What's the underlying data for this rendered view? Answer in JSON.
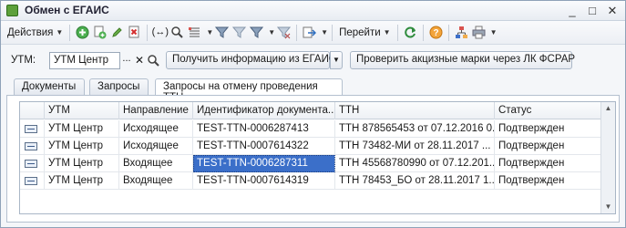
{
  "window": {
    "title": "Обмен с ЕГАИС",
    "controls": [
      "_",
      "□",
      "✕"
    ]
  },
  "toolbar": {
    "actions_label": "Действия",
    "goto_label": "Перейти",
    "icons": [
      "add-icon",
      "copy-icon",
      "edit-icon",
      "delete-icon",
      "pair-icon",
      "find-icon",
      "list-icon",
      "filter-icon",
      "filter-options-icon",
      "clear-filter-icon",
      "export-icon",
      "refresh-icon",
      "help-icon",
      "structure-icon",
      "print-icon"
    ]
  },
  "filter": {
    "label": "УТМ:",
    "value": "УТМ Центр",
    "dots": "...",
    "get_info_label": "Получить информацию из ЕГАИС",
    "check_marks_label": "Проверить акцизные марки через ЛК ФСРАР"
  },
  "tabs": [
    {
      "label": "Документы",
      "active": false
    },
    {
      "label": "Запросы",
      "active": false
    },
    {
      "label": "Запросы на отмену проведения ТТН",
      "active": true
    }
  ],
  "table": {
    "columns": [
      "УТМ",
      "Направление",
      "Идентификатор документа...",
      "ТТН",
      "Статус"
    ],
    "rows": [
      [
        "УТМ Центр",
        "Исходящее",
        "TEST-TTN-0006287413",
        "ТТН 878565453 от 07.12.2016 0...",
        "Подтвержден"
      ],
      [
        "УТМ Центр",
        "Исходящее",
        "TEST-TTN-0007614322",
        "ТТН 73482-МИ от 28.11.2017 ...",
        "Подтвержден"
      ],
      [
        "УТМ Центр",
        "Входящее",
        "TEST-TTN-0006287311",
        "ТТН 45568780990 от 07.12.201...",
        "Подтвержден"
      ],
      [
        "УТМ Центр",
        "Входящее",
        "TEST-TTN-0007614319",
        "ТТН 78453_БО от 28.11.2017 1...",
        "Подтвержден"
      ]
    ],
    "selected_row": 2,
    "selected_col": 2
  },
  "colors": {
    "selection": "#3b6fc9",
    "accent_green": "#5da03b"
  }
}
